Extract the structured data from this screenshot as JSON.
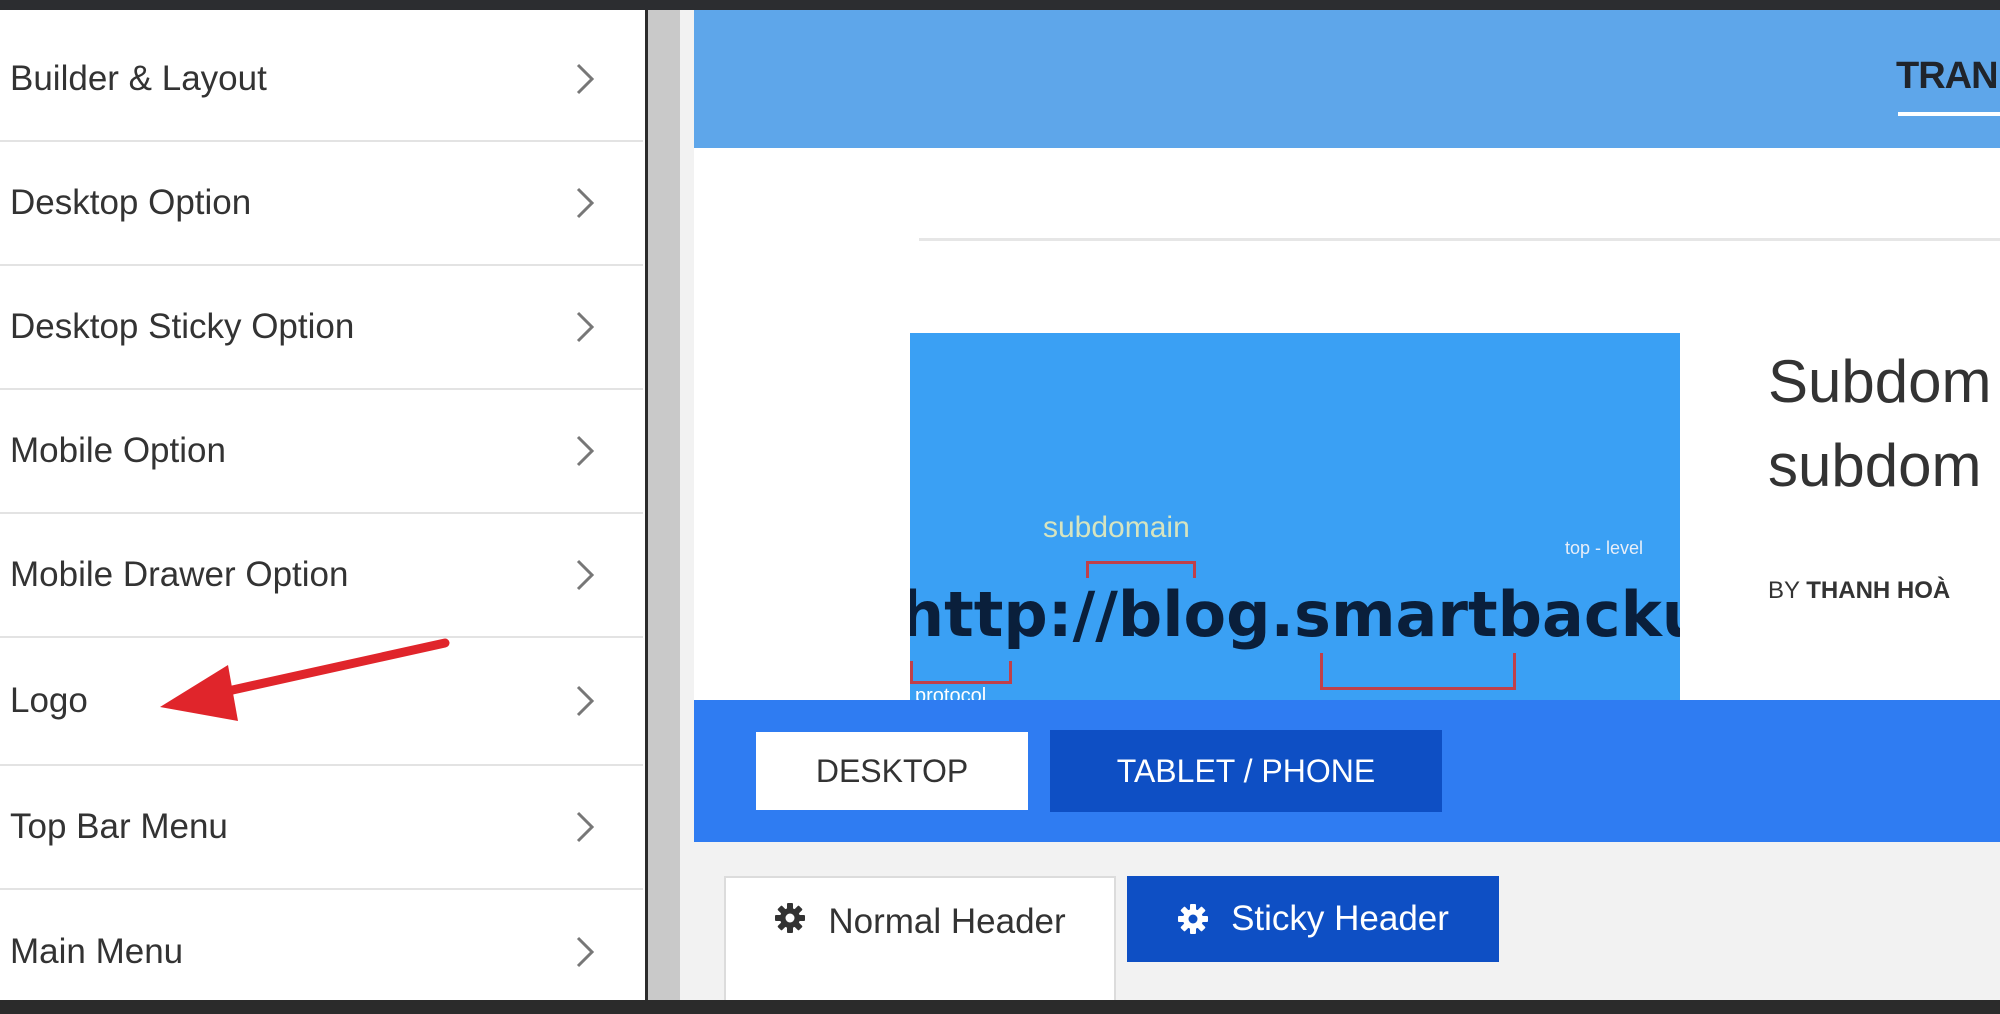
{
  "sidebar": {
    "items": [
      {
        "label": "Builder & Layout"
      },
      {
        "label": "Desktop Option"
      },
      {
        "label": "Desktop Sticky Option"
      },
      {
        "label": "Mobile Option"
      },
      {
        "label": "Mobile Drawer Option"
      },
      {
        "label": "Logo"
      },
      {
        "label": "Top Bar Menu"
      },
      {
        "label": "Main Menu"
      }
    ],
    "chevron_icon": "chevron-right-icon"
  },
  "annotation": {
    "icon": "red-arrow-icon",
    "color": "#e0252b"
  },
  "preview": {
    "nav_link": "TRAN",
    "thumbnail": {
      "url_text": "http://blog.smartbackup.vn",
      "subdomain_label": "subdomain",
      "tld_label": "top - level",
      "protocol_label": "protocol"
    },
    "post_title_line1": "Subdom",
    "post_title_line2": "subdom",
    "by_prefix": "BY",
    "author": "THANH HOÀ"
  },
  "device_toggle": {
    "desktop_label": "DESKTOP",
    "tablet_label": "TABLET / PHONE",
    "active": "TABLET / PHONE"
  },
  "header_tabs": {
    "normal_label": "Normal Header",
    "sticky_label": "Sticky Header",
    "icon": "gear-icon"
  },
  "colors": {
    "header_blue": "#5ea6ea",
    "toolbar_blue": "#2f7cf2",
    "active_blue": "#0e4fc4",
    "annotation_red": "#e0252b"
  }
}
